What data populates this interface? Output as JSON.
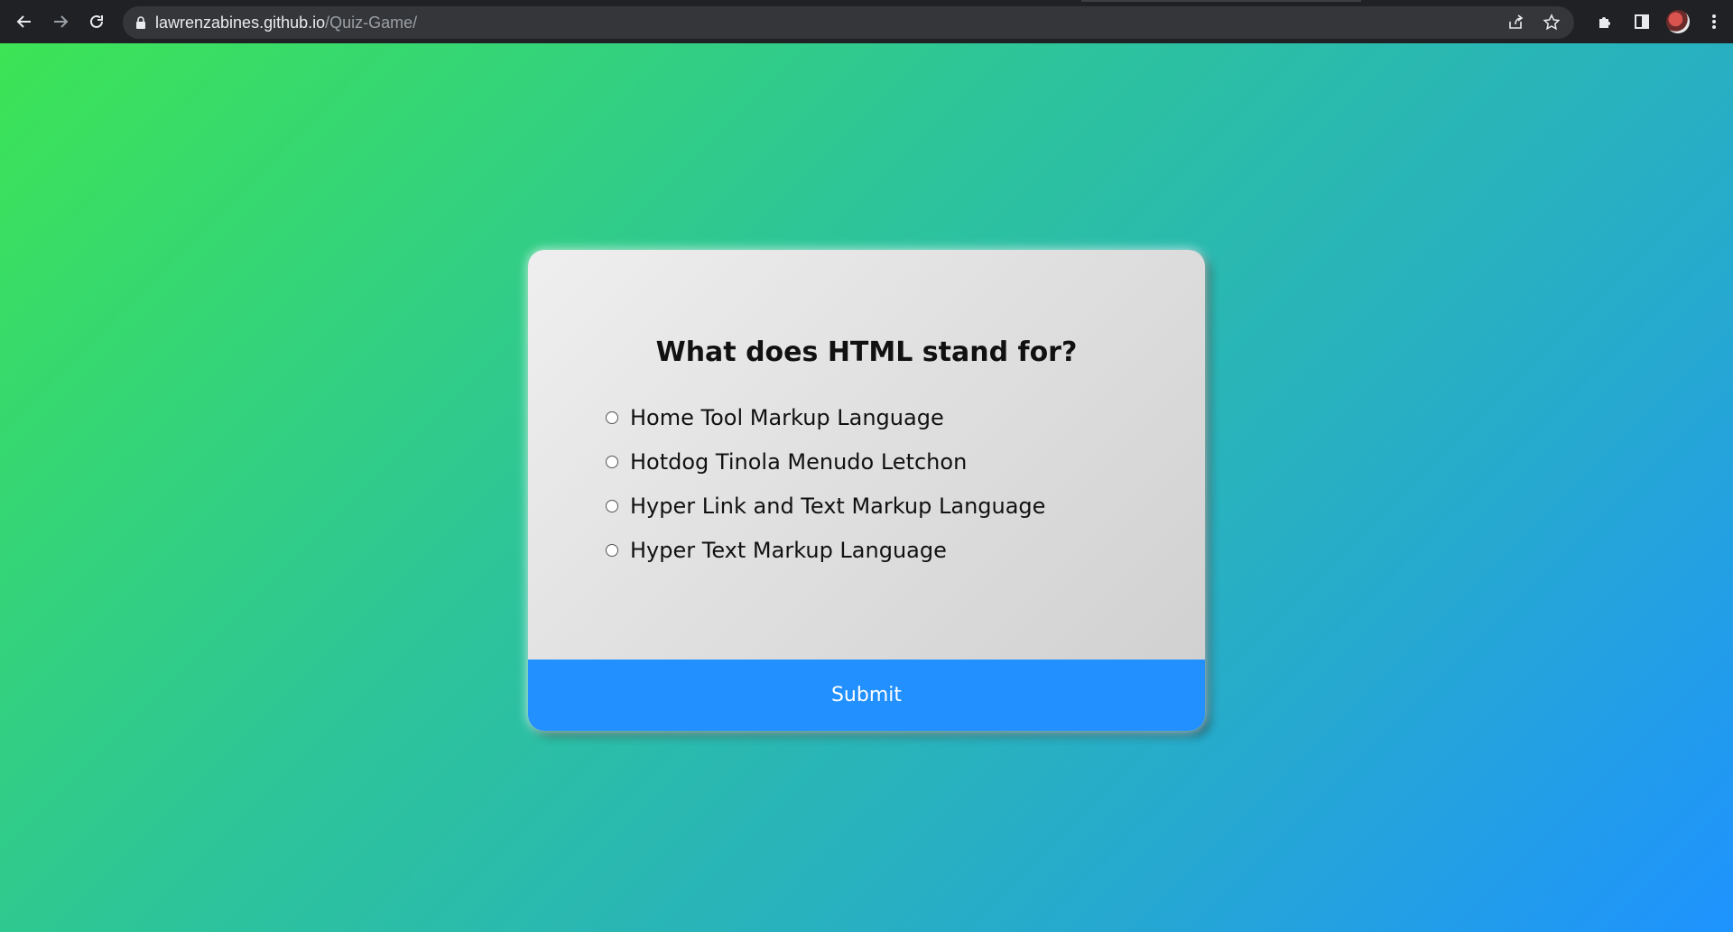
{
  "browser": {
    "url_host": "lawrenzabines.github.io",
    "url_path": "/Quiz-Game/"
  },
  "icons": {
    "back": "arrow-left-icon",
    "forward": "arrow-right-icon",
    "reload": "reload-icon",
    "lock": "lock-icon",
    "share": "share-icon",
    "bookmark": "star-icon",
    "extensions": "puzzle-icon",
    "side_panel": "side-panel-icon",
    "menu": "kebab-menu-icon"
  },
  "quiz": {
    "question": "What does HTML stand for?",
    "answers": [
      "Home Tool Markup Language",
      "Hotdog Tinola Menudo Letchon",
      "Hyper Link and Text Markup Language",
      "Hyper Text Markup Language"
    ],
    "submit_label": "Submit"
  },
  "colors": {
    "gradient_start": "#3ce455",
    "gradient_end": "#1e93ff",
    "submit_bg": "#2290ff"
  }
}
